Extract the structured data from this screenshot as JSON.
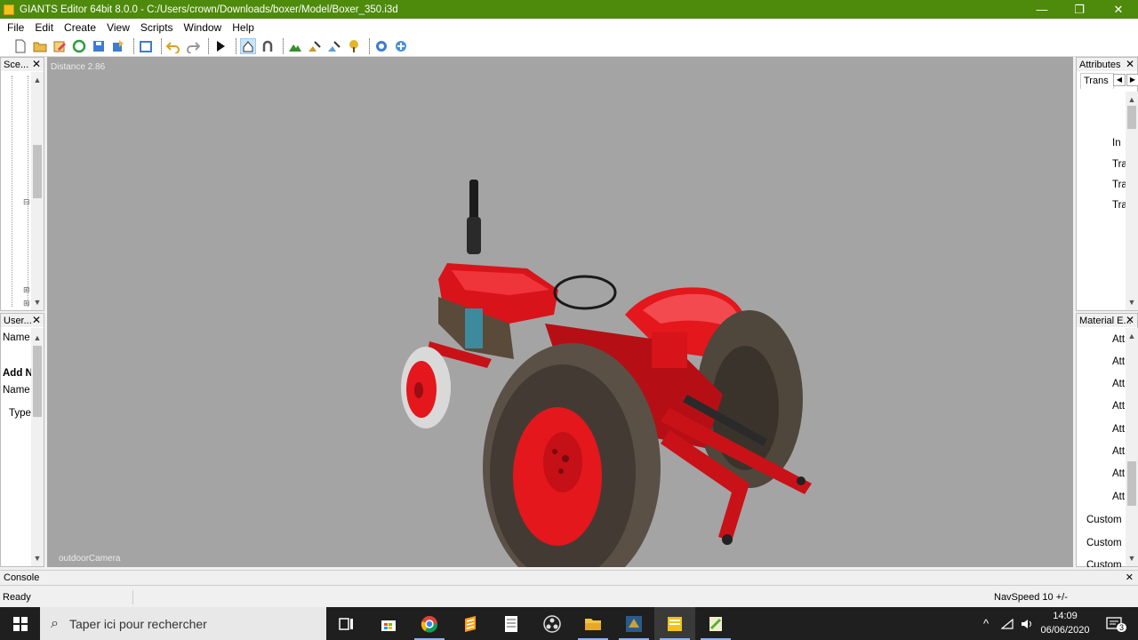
{
  "window": {
    "title": "GIANTS Editor 64bit 8.0.0 - C:/Users/crown/Downloads/boxer/Model/Boxer_350.i3d",
    "minimize": "—",
    "restore": "❐",
    "close": "✕"
  },
  "menu": [
    "File",
    "Edit",
    "Create",
    "View",
    "Scripts",
    "Window",
    "Help"
  ],
  "toolbar": {
    "icons": [
      "new-file-icon",
      "open-folder-icon",
      "edit-icon",
      "refresh-icon",
      "save-icon",
      "export-icon",
      "import-icon",
      "undo-icon",
      "redo-icon",
      "play-icon",
      "select-icon",
      "magnet-icon",
      "terrain-icon",
      "paint-icon",
      "sculpt-icon",
      "foliage-icon",
      "rotate-icon",
      "settings-icon"
    ]
  },
  "scenegraph_panel": {
    "title": "Sce...",
    "close": "✕"
  },
  "userattributes_panel": {
    "title": "User...",
    "close": "✕",
    "name_label": "Name",
    "add_label": "Add N",
    "name_label_2": "Name",
    "type_label": "Type"
  },
  "attributes_panel": {
    "title": "Attributes",
    "close": "✕",
    "tab": "Trans",
    "rows": [
      "In",
      "Tra",
      "Tra",
      "Tra"
    ]
  },
  "material_panel": {
    "title": "Material E...",
    "close": "✕",
    "rows": [
      "Att",
      "Att",
      "Att",
      "Att",
      "Att",
      "Att",
      "Att",
      "Att",
      "Custom",
      "Custom",
      "Custom"
    ]
  },
  "viewport": {
    "distance": "Distance 2.86",
    "camera": "outdoorCamera"
  },
  "console": {
    "title": "Console",
    "close": "✕"
  },
  "status": {
    "ready": "Ready",
    "navspeed": "NavSpeed 10 +/-"
  },
  "taskbar": {
    "search_placeholder": "Taper ici pour rechercher",
    "time": "14:09",
    "date": "06/06/2020",
    "notifications": "3"
  },
  "colors": {
    "titlebar": "#4e8a0b",
    "viewport_bg": "#a4a4a4",
    "tractor_red": "#e0141b"
  }
}
